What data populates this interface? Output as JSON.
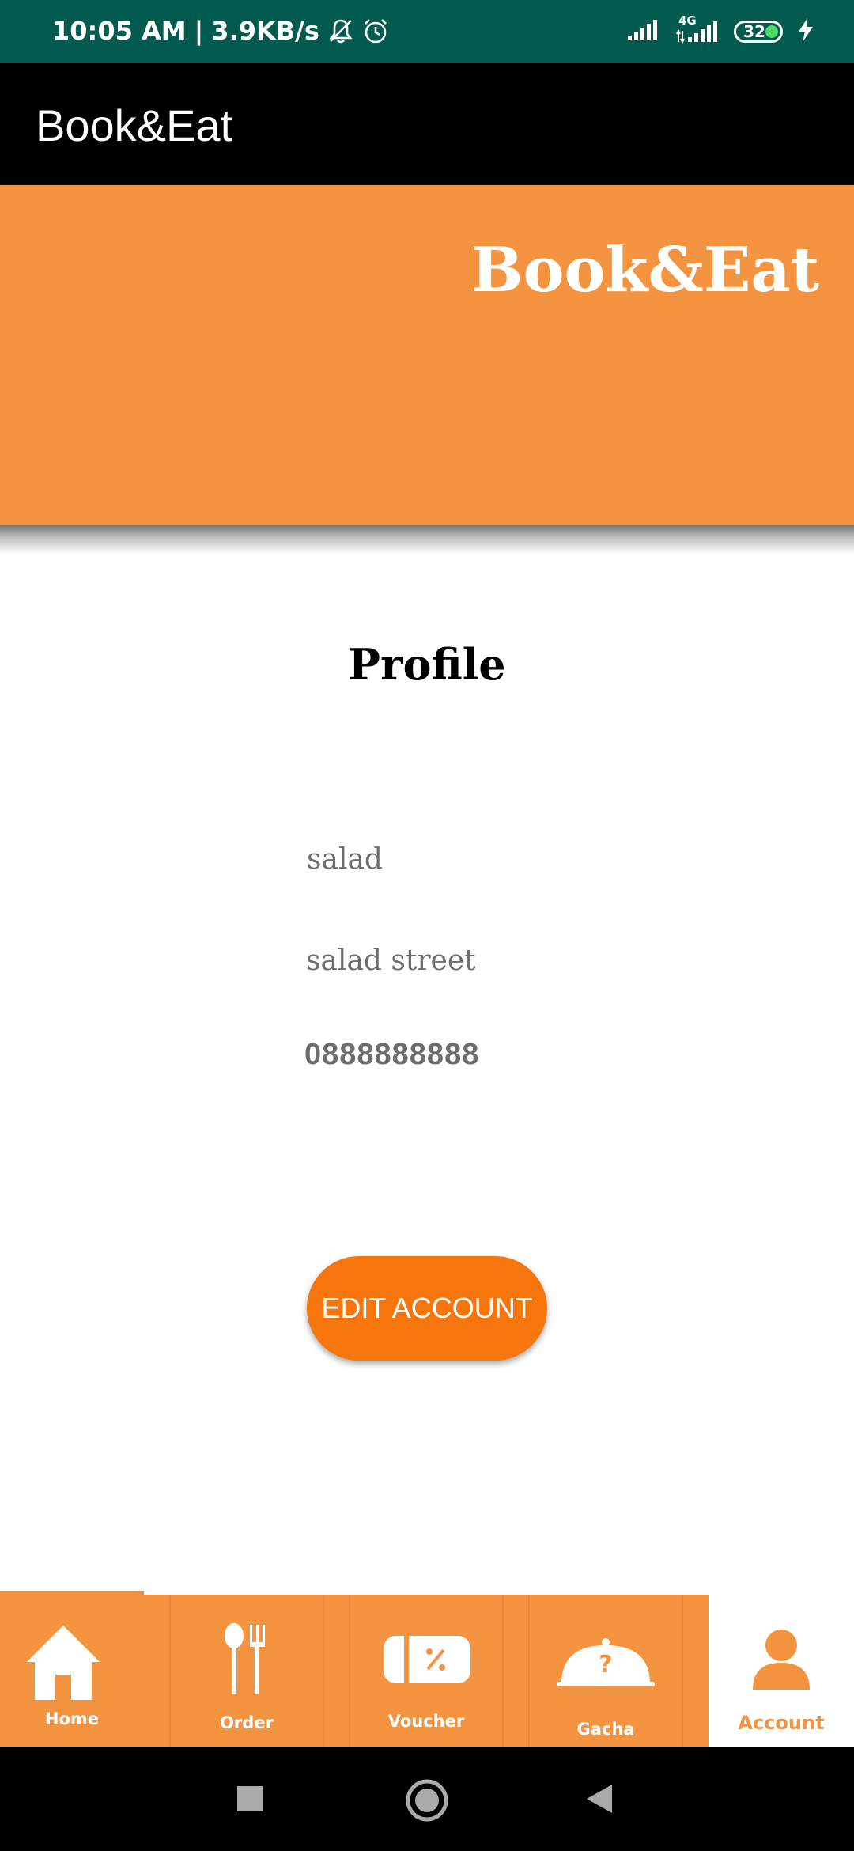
{
  "status_bar": {
    "time": "10:05 AM",
    "network_speed": "3.9KB/s",
    "separator": "|",
    "network_type": "4G",
    "battery": "32"
  },
  "app_bar": {
    "title": "Book&Eat"
  },
  "banner": {
    "title": "Book&Eat"
  },
  "profile": {
    "heading": "Profile",
    "name": "salad",
    "address": "salad street",
    "phone": "0888888888",
    "edit_button": "EDIT ACCOUNT"
  },
  "bottom_nav": {
    "items": [
      {
        "label": "Home",
        "icon": "home-icon"
      },
      {
        "label": "Order",
        "icon": "utensils-icon"
      },
      {
        "label": "Voucher",
        "icon": "voucher-icon"
      },
      {
        "label": "Gacha",
        "icon": "cloche-question-icon"
      },
      {
        "label": "Account",
        "icon": "user-icon",
        "selected": true
      }
    ]
  },
  "colors": {
    "status_bar": "#035b4f",
    "brand_orange": "#f49441",
    "button_orange": "#f6750d",
    "app_bar": "#000000"
  }
}
